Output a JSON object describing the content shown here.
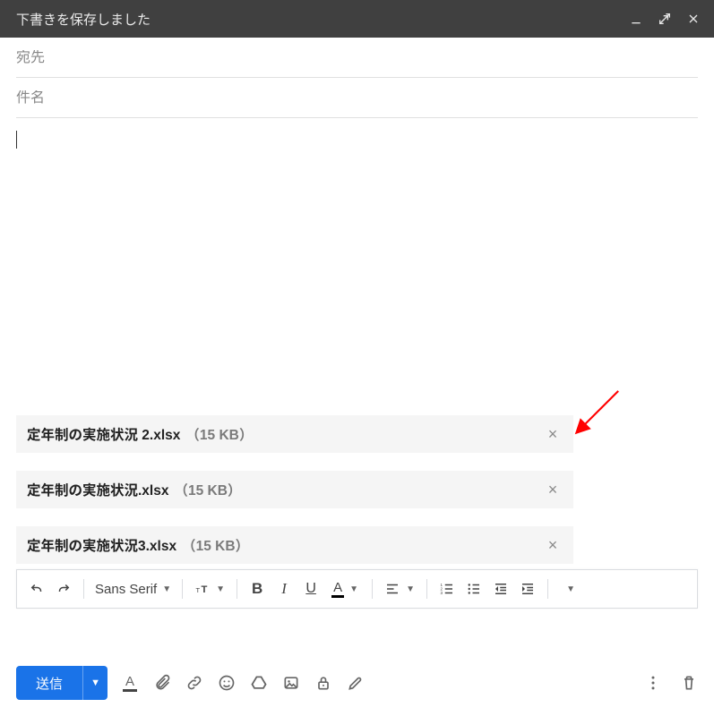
{
  "header": {
    "title": "下書きを保存しました"
  },
  "compose": {
    "to_placeholder": "宛先",
    "subject_placeholder": "件名",
    "to_value": "",
    "subject_value": "",
    "body_text": ""
  },
  "attachments": [
    {
      "name": "定年制の実施状況 2.xlsx",
      "size": "（15 KB）"
    },
    {
      "name": "定年制の実施状況.xlsx",
      "size": "（15 KB）"
    },
    {
      "name": "定年制の実施状況3.xlsx",
      "size": "（15 KB）"
    }
  ],
  "format": {
    "font_label": "Sans Serif"
  },
  "actions": {
    "send_label": "送信"
  },
  "colors": {
    "accent": "#1a73e8"
  }
}
